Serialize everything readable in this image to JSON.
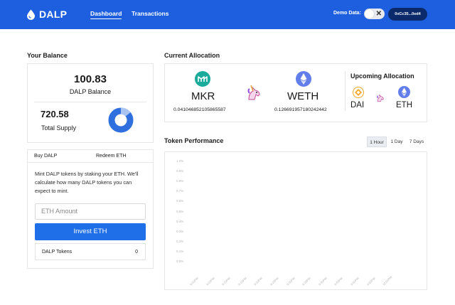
{
  "app": {
    "title": "DALP"
  },
  "nav": {
    "tabs": [
      {
        "label": "Dashboard",
        "active": true
      },
      {
        "label": "Transactions",
        "active": false
      }
    ]
  },
  "header": {
    "demo_label": "Demo Data:",
    "toggle_icon": "x-icon",
    "address": "0xCc35...0ed4"
  },
  "balance": {
    "section_title": "Your Balance",
    "dalp_value": "100.83",
    "dalp_label": "DALP Balance",
    "supply_value": "720.58",
    "supply_label": "Total Supply",
    "donut_fill_fraction": 0.14
  },
  "buy": {
    "tabs": [
      "Buy DALP",
      "Redeem ETH"
    ],
    "active_tab": "Buy DALP",
    "description": "Mint DALP tokens by staking your ETH. We'll calculate how many DALP tokens you can expect to mint.",
    "input_placeholder": "ETH Amount",
    "invest_label": "Invest ETH",
    "tokens_label": "DALP Tokens",
    "tokens_value": "0"
  },
  "allocation": {
    "section_title": "Current Allocation",
    "current": [
      {
        "symbol": "MKR",
        "amount": "0.041046852105865587",
        "icon": "mkr-icon"
      },
      {
        "symbol": "WETH",
        "amount": "0.126691957180242442",
        "icon": "eth-icon"
      }
    ],
    "upcoming_title": "Upcoming Allocation",
    "upcoming": [
      {
        "symbol": "DAI",
        "icon": "dai-icon"
      },
      {
        "symbol": "ETH",
        "icon": "eth-icon"
      }
    ]
  },
  "performance": {
    "section_title": "Token Performance",
    "ranges": [
      "1 Hour",
      "1 Day",
      "7 Days"
    ],
    "active_range": "1 Hour",
    "y_ticks": [
      "1.0%",
      "0.9%",
      "0.8%",
      "0.7%",
      "0.6%",
      "0.5%",
      "0.4%",
      "0.3%",
      "0.2%",
      "0.1%",
      "0.0%"
    ],
    "x_ticks": [
      "9:00PM",
      "9:05PM",
      "9:10PM",
      "9:15PM",
      "9:20PM",
      "9:25PM",
      "9:30PM",
      "9:35PM",
      "9:40PM",
      "9:45PM",
      "9:50PM",
      "9:55PM",
      "10:00PM"
    ]
  },
  "colors": {
    "brand": "#1e5fe0",
    "button": "#1e6fe8",
    "donut": "#2f6fde",
    "address_bg": "#0b2a6b"
  }
}
